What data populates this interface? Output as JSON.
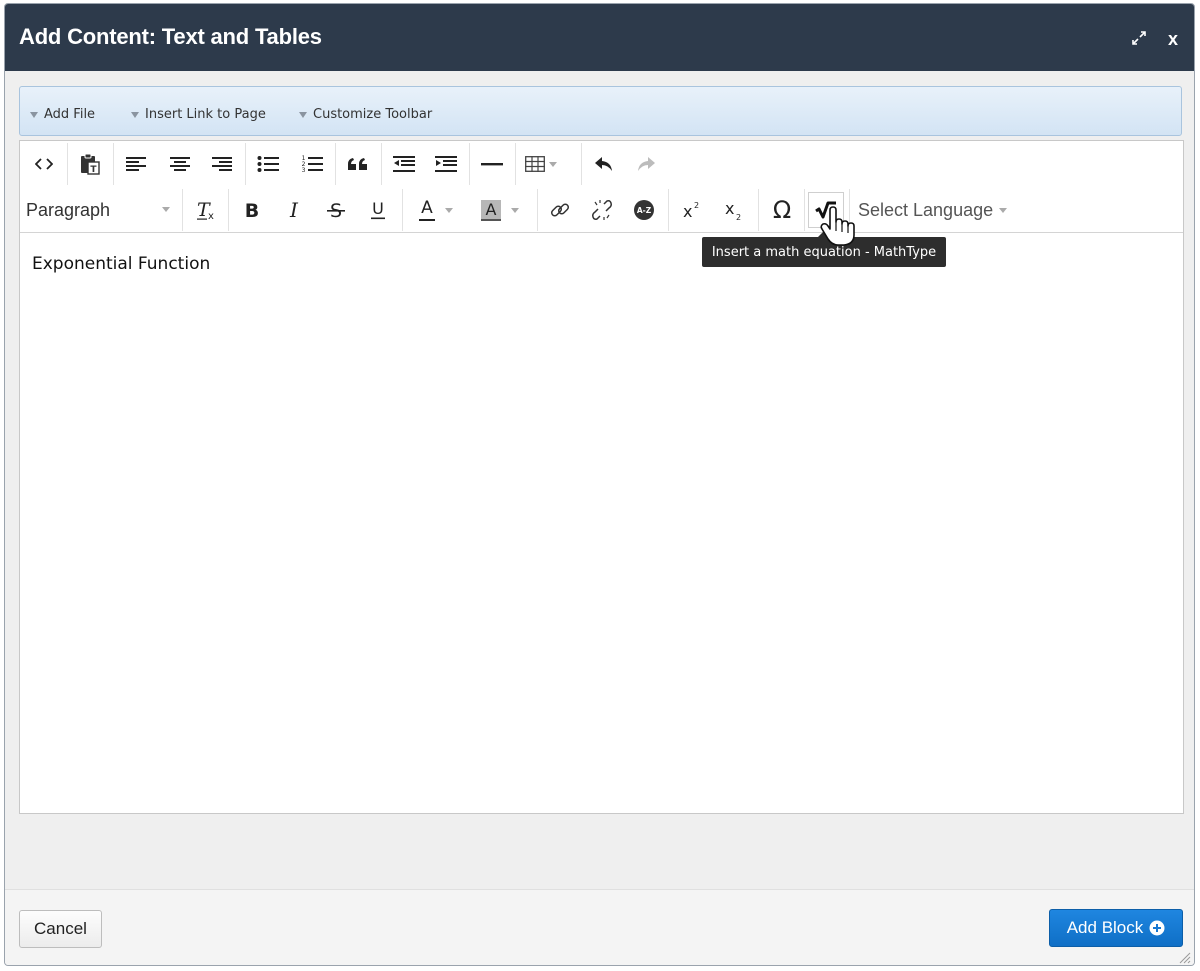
{
  "dialog": {
    "title": "Add Content: Text and Tables",
    "close_label": "x"
  },
  "actionbar": {
    "items": [
      {
        "label": "Add File"
      },
      {
        "label": "Insert Link to Page"
      },
      {
        "label": "Customize Toolbar"
      }
    ]
  },
  "toolbar": {
    "row1_icons": [
      "code-view-icon",
      "paste-text-icon",
      "align-left-icon",
      "align-center-icon",
      "align-right-icon",
      "bullet-list-icon",
      "numbered-list-icon",
      "blockquote-icon",
      "outdent-icon",
      "indent-icon",
      "horizontal-rule-icon",
      "table-icon",
      "undo-icon",
      "redo-icon"
    ],
    "paragraph_format": "Paragraph",
    "row2_icons": [
      "clear-formatting-icon",
      "bold-icon",
      "italic-icon",
      "strikethrough-icon",
      "underline-icon",
      "text-color-icon",
      "background-color-icon",
      "link-icon",
      "unlink-icon",
      "spellcheck-icon",
      "superscript-icon",
      "subscript-icon",
      "special-character-icon",
      "mathtype-icon"
    ],
    "font_color_letter": "A",
    "bg_color_letter": "A",
    "omega": "Ω",
    "select_language": "Select Language"
  },
  "tooltip": {
    "text": "Insert a math equation - MathType"
  },
  "editor": {
    "content": "Exponential Function"
  },
  "footer": {
    "cancel_label": "Cancel",
    "add_label": "Add Block"
  },
  "colors": {
    "titlebar": "#2d3a4b",
    "primary_button": "#1677d2",
    "tooltip_bg": "#2d2d2d"
  }
}
